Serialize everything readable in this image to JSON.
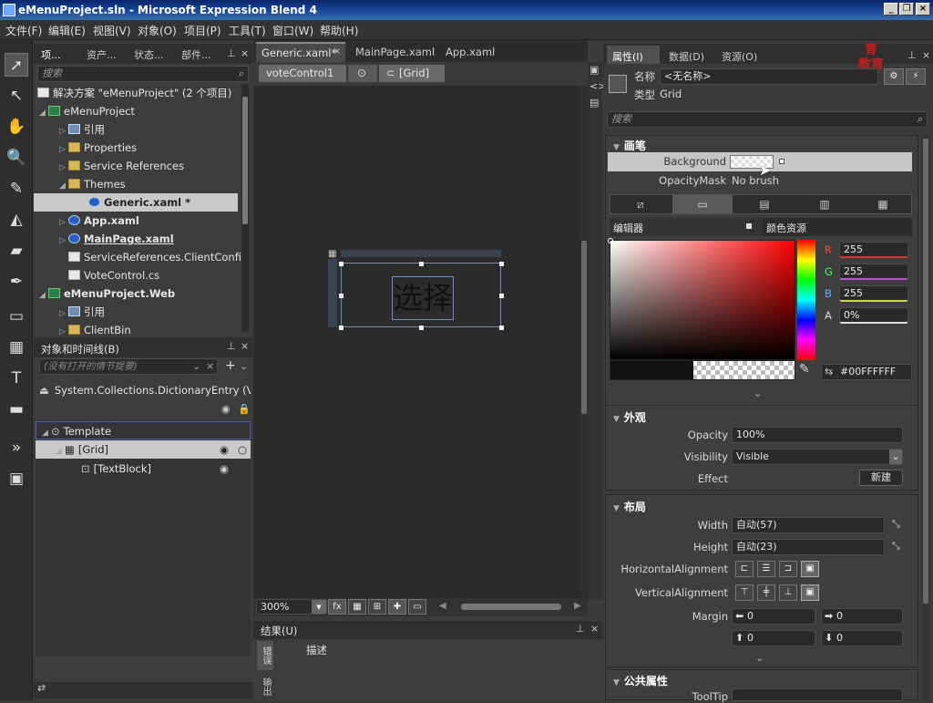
{
  "window": {
    "title": "eMenuProject.sln - Microsoft Expression Blend 4"
  },
  "menu": [
    "文件(F)",
    "编辑(E)",
    "视图(V)",
    "对象(O)",
    "项目(P)",
    "工具(T)",
    "窗口(W)",
    "帮助(H)"
  ],
  "project_panel": {
    "tabs": [
      "项...",
      "资产...",
      "状态...",
      "部件..."
    ],
    "search_placeholder": "搜索",
    "tree": [
      "解决方案 \"eMenuProject\" (2 个项目)",
      "eMenuProject",
      "引用",
      "Properties",
      "Service References",
      "Themes",
      "Generic.xaml *",
      "App.xaml",
      "MainPage.xaml",
      "ServiceReferences.ClientConfig",
      "VoteControl.cs",
      "eMenuProject.Web",
      "引用",
      "ClientBin"
    ]
  },
  "objects_panel": {
    "title": "对象和时间线(B)",
    "storyboard_placeholder": "(没有打开的情节提要)",
    "scope": "System.Collections.DictionaryEntry (Vo...",
    "tree": [
      "Template",
      "[Grid]",
      "[TextBlock]"
    ]
  },
  "document": {
    "tabs": [
      "Generic.xaml*",
      "MainPage.xaml",
      "App.xaml"
    ],
    "breadcrumb": [
      "voteControl1",
      "[Grid]"
    ],
    "canvas_text": "选择",
    "zoom": "300%"
  },
  "results_panel": {
    "title": "结果(U)",
    "side_tabs": [
      "错误",
      "输出"
    ],
    "column": "描述"
  },
  "properties_panel": {
    "tabs": [
      "属性(I)",
      "数据(D)",
      "资源(O)"
    ],
    "name_label": "名称",
    "name_value": "<无名称>",
    "type_label": "类型",
    "type_value": "Grid",
    "search_placeholder": "搜索",
    "brushes": {
      "title": "画笔",
      "background_label": "Background",
      "opacity_mask_label": "OpacityMask",
      "opacity_mask_value": "No brush",
      "editor_tab": "编辑器",
      "color_resources_tab": "颜色资源",
      "r_label": "R",
      "r": "255",
      "g_label": "G",
      "g": "255",
      "b_label": "B",
      "b": "255",
      "a_label": "A",
      "a": "0%",
      "hex": "#00FFFFFF"
    },
    "appearance": {
      "title": "外观",
      "opacity_label": "Opacity",
      "opacity": "100%",
      "visibility_label": "Visibility",
      "visibility": "Visible",
      "effect_label": "Effect",
      "new_button": "新建"
    },
    "layout": {
      "title": "布局",
      "width_label": "Width",
      "width": "自动(57)",
      "height_label": "Height",
      "height": "自动(23)",
      "halign_label": "HorizontalAlignment",
      "valign_label": "VerticalAlignment",
      "margin_label": "Margin",
      "margin": [
        "0",
        "0",
        "0",
        "0"
      ]
    },
    "common": {
      "title": "公共属性",
      "tooltip_label": "ToolTip"
    }
  },
  "colors": {
    "accent": "#1c4d9e",
    "selection": "#c9c9c9",
    "canvas": "#2b2b2b"
  }
}
